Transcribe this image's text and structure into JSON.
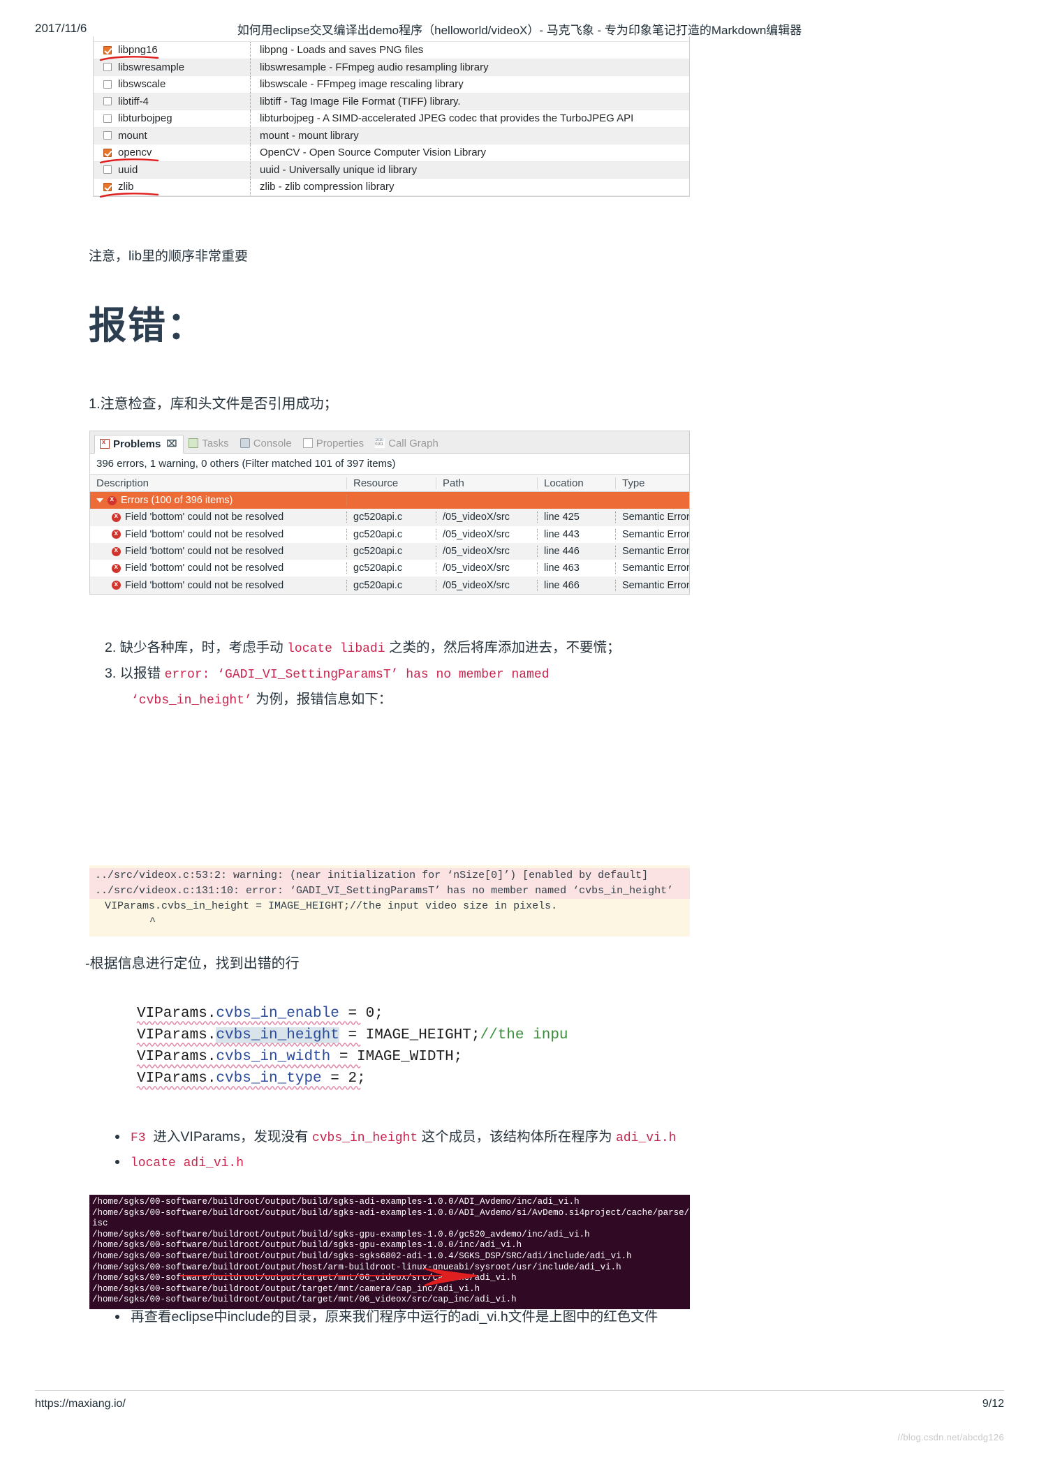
{
  "page": {
    "date": "2017/11/6",
    "title": "如何用eclipse交叉编译出demo程序（helloworld/videoX）- 马克飞象 - 专为印象笔记打造的Markdown编辑器",
    "footer_url": "https://maxiang.io/",
    "page_number": "9/12",
    "watermark": "//blog.csdn.net/abcdg126"
  },
  "lib_table": {
    "rows": [
      {
        "checked": true,
        "name": "libpng16",
        "desc": "libpng - Loads and saves PNG files",
        "underline": true
      },
      {
        "checked": false,
        "name": "libswresample",
        "desc": "libswresample - FFmpeg audio resampling library",
        "underline": false
      },
      {
        "checked": false,
        "name": "libswscale",
        "desc": "libswscale - FFmpeg image rescaling library",
        "underline": false
      },
      {
        "checked": false,
        "name": "libtiff-4",
        "desc": "libtiff - Tag Image File Format (TIFF) library.",
        "underline": false
      },
      {
        "checked": false,
        "name": "libturbojpeg",
        "desc": "libturbojpeg - A SIMD-accelerated JPEG codec that provides the TurboJPEG API",
        "underline": false
      },
      {
        "checked": false,
        "name": "mount",
        "desc": "mount - mount library",
        "underline": false
      },
      {
        "checked": true,
        "name": "opencv",
        "desc": "OpenCV - Open Source Computer Vision Library",
        "underline": true
      },
      {
        "checked": false,
        "name": "uuid",
        "desc": "uuid - Universally unique id library",
        "underline": false
      },
      {
        "checked": true,
        "name": "zlib",
        "desc": "zlib - zlib compression library",
        "underline": true
      }
    ],
    "note": "注意，lib里的顺序非常重要"
  },
  "heading": "报错：",
  "para1": "1.注意检查，库和头文件是否引用成功；",
  "problems_view": {
    "tabs": [
      {
        "label": "Problems",
        "icon": "problems-icon",
        "active": true,
        "closeable": true
      },
      {
        "label": "Tasks",
        "icon": "tasks-icon",
        "active": false,
        "closeable": false
      },
      {
        "label": "Console",
        "icon": "console-icon",
        "active": false,
        "closeable": false
      },
      {
        "label": "Properties",
        "icon": "properties-icon",
        "active": false,
        "closeable": false
      },
      {
        "label": "Call Graph",
        "icon": "call-graph-icon",
        "active": false,
        "closeable": false
      }
    ],
    "summary": "396 errors, 1 warning, 0 others (Filter matched 101 of 397 items)",
    "columns": [
      "Description",
      "Resource",
      "Path",
      "Location",
      "Type"
    ],
    "group_row": "Errors (100 of 396 items)",
    "rows": [
      {
        "description": "Field 'bottom' could not be resolved",
        "resource": "gc520api.c",
        "path": "/05_videoX/src",
        "location": "line 425",
        "type": "Semantic Error"
      },
      {
        "description": "Field 'bottom' could not be resolved",
        "resource": "gc520api.c",
        "path": "/05_videoX/src",
        "location": "line 443",
        "type": "Semantic Error"
      },
      {
        "description": "Field 'bottom' could not be resolved",
        "resource": "gc520api.c",
        "path": "/05_videoX/src",
        "location": "line 446",
        "type": "Semantic Error"
      },
      {
        "description": "Field 'bottom' could not be resolved",
        "resource": "gc520api.c",
        "path": "/05_videoX/src",
        "location": "line 463",
        "type": "Semantic Error"
      },
      {
        "description": "Field 'bottom' could not be resolved",
        "resource": "gc520api.c",
        "path": "/05_videoX/src",
        "location": "line 466",
        "type": "Semantic Error"
      }
    ]
  },
  "ordered_list": {
    "item2_a": "2. 缺少各种库，时，考虑手动 ",
    "item2_code": "locate libadi",
    "item2_b": " 之类的，然后将库添加进去，不要慌；",
    "item3_a": "3. 以报错 ",
    "item3_code": "error: ‘GADI_VI_SettingParamsT’ has no member named",
    "item3_code2": "‘cvbs_in_height’",
    "item3_b": " 为例，报错信息如下："
  },
  "error_block": {
    "line1": "../src/videox.c:53:2: warning: (near initialization for ‘nSize[0]’) [enabled by default]",
    "line2": "../src/videox.c:131:10: error: ‘GADI_VI_SettingParamsT’ has no member named ‘cvbs_in_height’",
    "line3": "VIParams.cvbs_in_height = IMAGE_HEIGHT;//the input video size in pixels.",
    "line4": "^"
  },
  "para2": "-根据信息进行定位，找到出错的行",
  "code_shot": {
    "lines": [
      {
        "pre": "VIParams.",
        "mid": "cvbs_in_enable",
        "post": " = 0;",
        "tail": ""
      },
      {
        "pre": "VIParams.",
        "mid": "cvbs_in_height",
        "post": " = IMAGE_HEIGHT;",
        "tail": "//the inpu"
      },
      {
        "pre": "VIParams.",
        "mid": "cvbs_in_width",
        "post": "  = IMAGE_WIDTH;",
        "tail": ""
      },
      {
        "pre": "VIParams.",
        "mid": "cvbs_in_type",
        "post": "   = 2;",
        "tail": ""
      }
    ]
  },
  "bullets": {
    "b1_a": "F3 ",
    "b1_b": "进入VIParams，发现没有 ",
    "b1_code": "cvbs_in_height",
    "b1_c": " 这个成员，该结构体所在程序为 ",
    "b1_code2": "adi_vi.h",
    "b2_code": "locate adi_vi.h"
  },
  "terminal": {
    "lines": [
      "/home/sgks/00-software/buildroot/output/build/sgks-adi-examples-1.0.0/ADI_Avdemo/inc/adi_vi.h",
      "/home/sgks/00-software/buildroot/output/build/sgks-adi-examples-1.0.0/ADI_Avdemo/si/AvDemo.si4project/cache/parse/inc_adi_vi.h.s",
      "isc",
      "/home/sgks/00-software/buildroot/output/build/sgks-gpu-examples-1.0.0/gc520_avdemo/inc/adi_vi.h",
      "/home/sgks/00-software/buildroot/output/build/sgks-gpu-examples-1.0.0/inc/adi_vi.h",
      "/home/sgks/00-software/buildroot/output/build/sgks-sgks6802-adi-1.0.4/SGKS_DSP/SRC/adi/include/adi_vi.h",
      "/home/sgks/00-software/buildroot/output/host/arm-buildroot-linux-gnueabi/sysroot/usr/include/adi_vi.h",
      "/home/sgks/00-software/buildroot/output/target/mnt/06_videox/src/cap_inc/adi_vi.h",
      "/home/sgks/00-software/buildroot/output/target/mnt/camera/cap_inc/adi_vi.h",
      "/home/sgks/00-software/buildroot/output/target/mnt/06_videox/src/cap_inc/adi_vi.h"
    ]
  },
  "bullet_last": "再查看eclipse中include的目录，原来我们程序中运行的adi_vi.h文件是上图中的红色文件"
}
